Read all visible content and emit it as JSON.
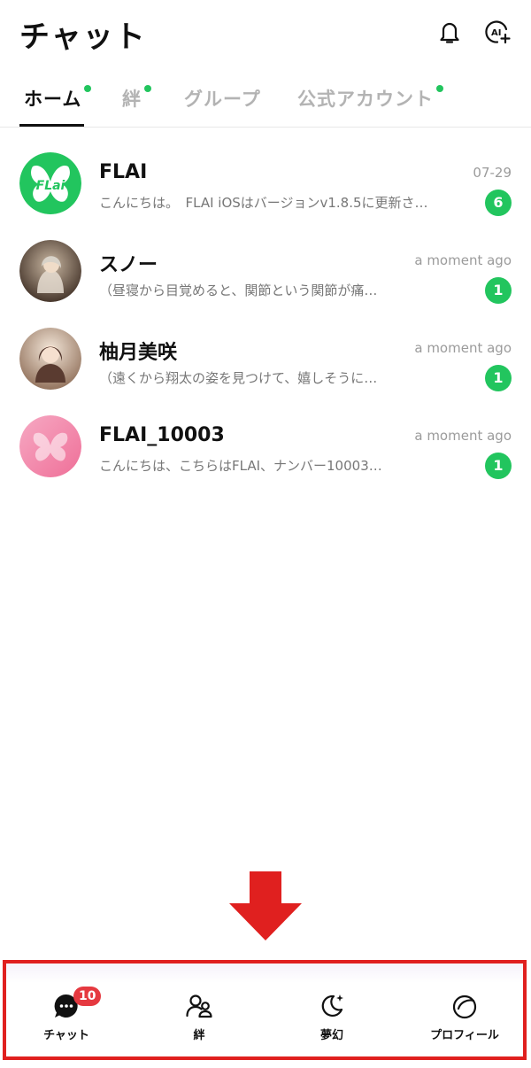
{
  "header": {
    "title": "チャット",
    "bell_icon": "bell-icon",
    "ai_icon": "ai-plus-icon"
  },
  "tabs": [
    {
      "label": "ホーム",
      "active": true,
      "dot": true
    },
    {
      "label": "絆",
      "active": false,
      "dot": true
    },
    {
      "label": "グループ",
      "active": false,
      "dot": false
    },
    {
      "label": "公式アカウント",
      "active": false,
      "dot": true
    }
  ],
  "chats": [
    {
      "name": "FLAI",
      "time": "07-29",
      "preview": "こんにちは。　FLAI iOSはバージョンv1.8.5に更新さ…",
      "unread": "6",
      "avatar_text": "FLai"
    },
    {
      "name": "スノー",
      "time": "a moment ago",
      "preview": "（昼寝から目覚めると、関節という関節が痛…",
      "unread": "1"
    },
    {
      "name": "柚月美咲",
      "time": "a moment ago",
      "preview": "（遠くから翔太の姿を見つけて、嬉しそうに…",
      "unread": "1"
    },
    {
      "name": "FLAI_10003",
      "time": "a moment ago",
      "preview": "こんにちは、こちらはFLAI、ナンバー10003…",
      "unread": "1"
    }
  ],
  "bottom_nav": [
    {
      "label": "チャット",
      "icon": "chat-bubble-icon",
      "badge": "10",
      "active": true
    },
    {
      "label": "絆",
      "icon": "users-icon"
    },
    {
      "label": "夢幻",
      "icon": "moon-star-icon"
    },
    {
      "label": "プロフィール",
      "icon": "profile-circle-icon"
    }
  ],
  "colors": {
    "accent_green": "#22c55e",
    "badge_red": "#e53940",
    "annotation_red": "#e0201f"
  }
}
